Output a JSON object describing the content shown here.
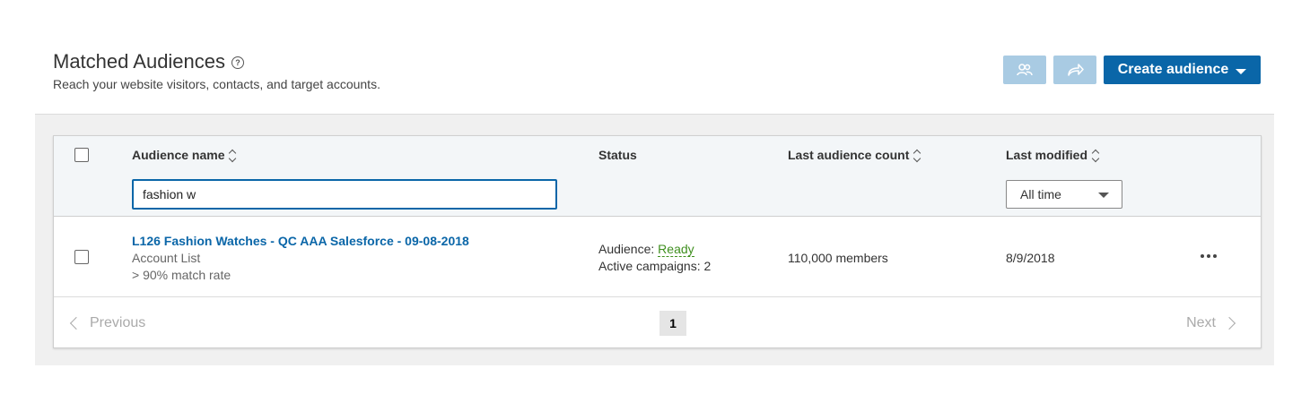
{
  "header": {
    "title": "Matched Audiences",
    "subtitle": "Reach your website visitors, contacts, and target accounts.",
    "create_label": "Create audience"
  },
  "table": {
    "columns": [
      "Audience name",
      "Status",
      "Last audience count",
      "Last modified"
    ],
    "search_value": "fashion w",
    "date_filter": "All time",
    "rows": [
      {
        "name": "L126 Fashion Watches - QC AAA Salesforce - 09-08-2018",
        "type": "Account List",
        "match_rate": "> 90% match rate",
        "audience_label": "Audience:",
        "audience_status": "Ready",
        "campaigns": "Active campaigns: 2",
        "count": "110,000 members",
        "modified": "8/9/2018"
      }
    ]
  },
  "pagination": {
    "previous": "Previous",
    "page": "1",
    "next": "Next"
  },
  "colors": {
    "brand": "#0a66a8",
    "disabled_button": "#a9cbe3",
    "ready": "#3f8f1f"
  },
  "icons": [
    "help-icon",
    "users-icon",
    "share-icon",
    "sort-icon",
    "caret-down-icon",
    "more-icon",
    "chevron-left-icon",
    "chevron-right-icon"
  ]
}
